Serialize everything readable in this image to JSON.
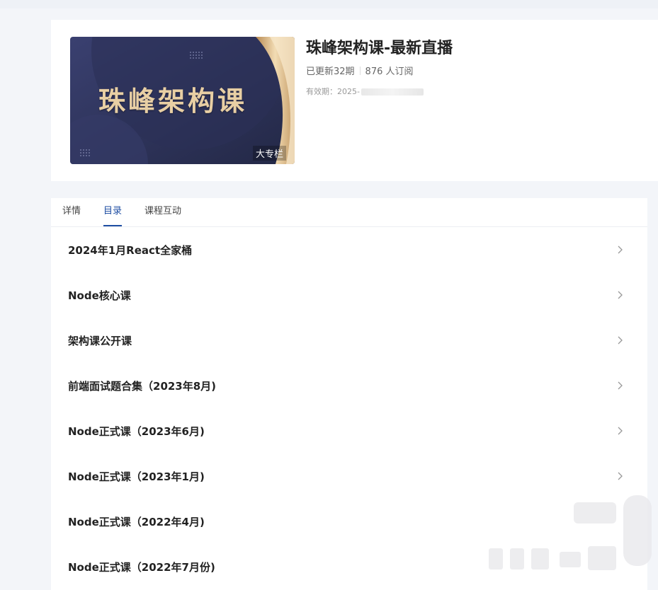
{
  "header": {
    "cover_text": "珠峰架构课",
    "cover_badge": "大专栏",
    "title": "珠峰架构课-最新直播",
    "updated": "已更新32期",
    "subscribers": "876 人订阅",
    "validity_label": "有效期：2025-"
  },
  "tabs": [
    {
      "label": "详情"
    },
    {
      "label": "目录"
    },
    {
      "label": "课程互动"
    }
  ],
  "catalog": [
    {
      "label": "2024年1月React全家桶"
    },
    {
      "label": "Node核心课"
    },
    {
      "label": "架构课公开课"
    },
    {
      "label": "前端面试题合集（2023年8月)"
    },
    {
      "label": "Node正式课（2023年6月)"
    },
    {
      "label": "Node正式课（2023年1月)"
    },
    {
      "label": "Node正式课（2022年4月)"
    },
    {
      "label": "Node正式课（2022年7月份)"
    }
  ],
  "colors": {
    "accent": "#1f4ea3",
    "cover_bg": "#2f3561",
    "cover_gold": "#e8cfa4"
  }
}
